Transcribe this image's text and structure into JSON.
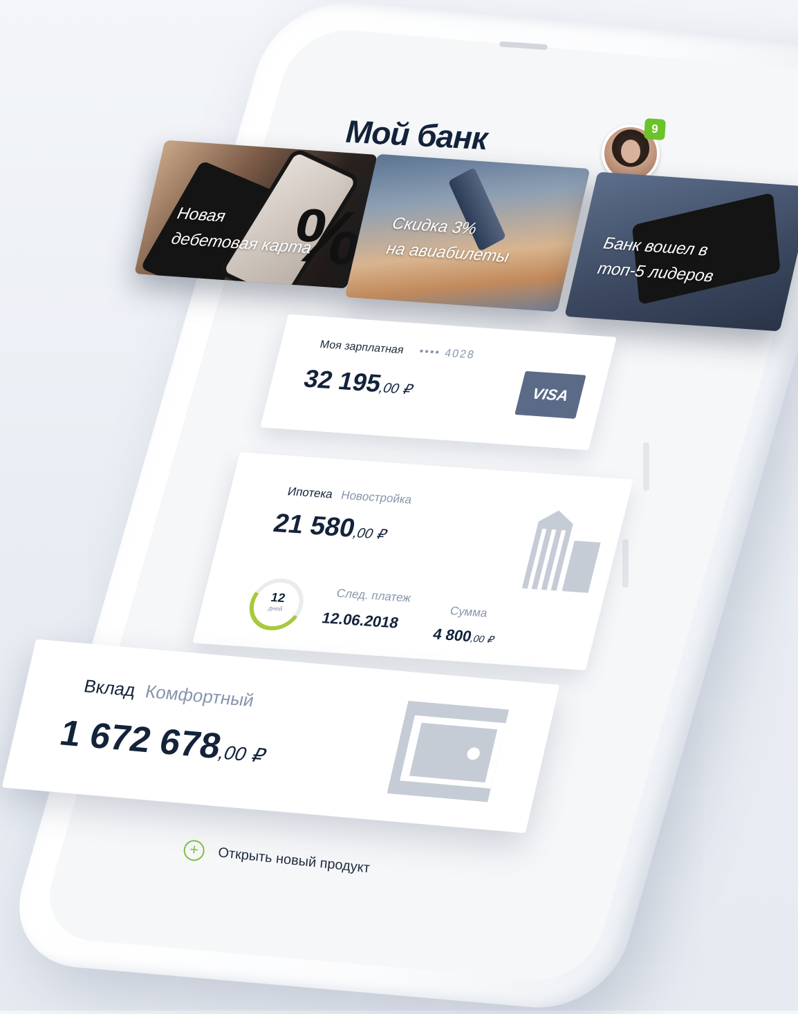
{
  "app": {
    "title": "Мой банк",
    "notifications_count": "9"
  },
  "promos": [
    {
      "line1": "Новая",
      "line2": "дебетовая карта"
    },
    {
      "line1": "Скидка 3%",
      "line2": "на  авиабилеты"
    },
    {
      "line1": "Банк вошел в",
      "line2": "топ-5 лидеров"
    }
  ],
  "salary_card": {
    "name": "Моя зарплатная",
    "masked": "•••• 4028",
    "amount_int": "32 195",
    "amount_dec": ",00 ₽",
    "brand": "VISA"
  },
  "mortgage": {
    "name": "Ипотека",
    "type": "Новостройка",
    "amount_int": "21 580",
    "amount_dec": ",00 ₽",
    "days_left": "12",
    "days_label": "дней",
    "days_fraction": 0.4,
    "next_payment_label": "След. платеж",
    "next_payment_date": "12.06.2018",
    "sum_label": "Сумма",
    "sum_int": "4 800",
    "sum_dec": ",00 ₽"
  },
  "deposit": {
    "name": "Вклад",
    "type": "Комфортный",
    "amount_int": "1 672 678",
    "amount_dec": ",00 ₽"
  },
  "actions": {
    "open_new_product": "Открыть новый продукт"
  }
}
